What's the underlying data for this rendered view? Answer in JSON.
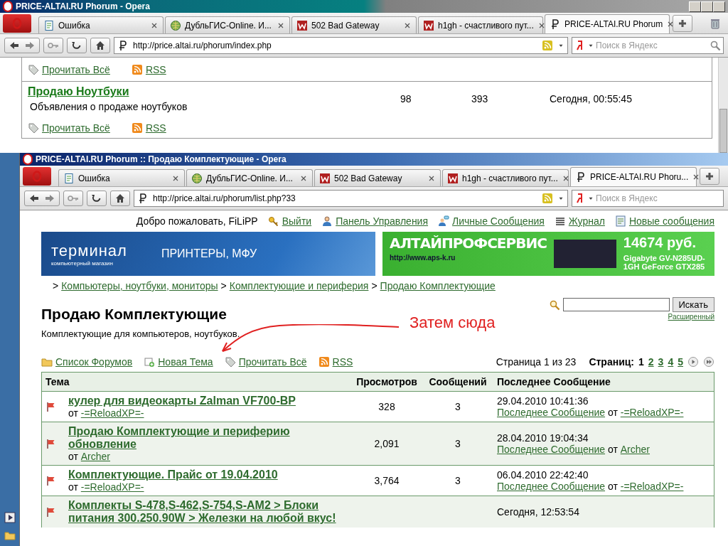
{
  "back_window": {
    "title": "PRICE-ALTAI.RU Phorum - Opera",
    "tabs": [
      {
        "label": "Ошибка",
        "kind": "page",
        "selected": false
      },
      {
        "label": "ДубльГИС-Online. И...",
        "kind": "globe",
        "selected": false
      },
      {
        "label": "502 Bad Gateway",
        "kind": "w",
        "selected": false
      },
      {
        "label": "h1gh - счастливого пут...",
        "kind": "w",
        "selected": false
      },
      {
        "label": "PRICE-ALTAI.RU Phorum",
        "kind": "p",
        "selected": true
      }
    ],
    "address": "http://price.altai.ru/phorum/index.php",
    "search_placeholder": "Поиск в Яндекс",
    "forum_rows": [
      {
        "links": [
          {
            "label": "Прочитать Всё",
            "kind": "tag"
          },
          {
            "label": "RSS",
            "kind": "rss"
          }
        ]
      },
      {
        "title": "Продаю Ноутбуки",
        "description": "Объявления о продаже ноутбуков",
        "topics": "98",
        "posts": "393",
        "last_post": "Сегодня, 00:55:45",
        "links": [
          {
            "label": "Прочитать Всё",
            "kind": "tag"
          },
          {
            "label": "RSS",
            "kind": "rss"
          }
        ]
      }
    ]
  },
  "front_window": {
    "title": "PRICE-ALTAI.RU Phorum :: Продаю Комплектующие - Opera",
    "tabs": [
      {
        "label": "Ошибка",
        "kind": "page",
        "selected": false
      },
      {
        "label": "ДубльГИС-Online. И...",
        "kind": "globe",
        "selected": false
      },
      {
        "label": "502 Bad Gateway",
        "kind": "w",
        "selected": false
      },
      {
        "label": "h1gh - счастливого пут...",
        "kind": "w",
        "selected": false
      },
      {
        "label": "PRICE-ALTAI.RU Phoru...",
        "kind": "p",
        "selected": true
      }
    ],
    "address": "http://price.altai.ru/phorum/list.php?33",
    "search_placeholder": "Поиск в Яндекс",
    "page": {
      "welcome": "Добро пожаловать, FiLiPP",
      "user_links": [
        {
          "label": "Выйти",
          "kind": "key"
        },
        {
          "label": "Панель Управления",
          "kind": "person"
        },
        {
          "label": "Личные Сообщения",
          "kind": "chat"
        },
        {
          "label": "Журнал",
          "kind": "list"
        },
        {
          "label": "Новые сообщения",
          "kind": "doc"
        }
      ],
      "banners": [
        {
          "kind": "terminal",
          "texts": [
            "терминал",
            "компьютерный магазин",
            "ПРИНТЕРЫ, МФУ"
          ]
        },
        {
          "kind": "aps",
          "texts": [
            "АЛТАЙПРОФСЕРВИС",
            "http://www.aps-k.ru",
            "14674 руб.",
            "Gigabyte GV-N285UD-1GH GeForce GTX285"
          ]
        }
      ],
      "breadcrumb_separator": ">",
      "breadcrumb": [
        "Компьютеры, ноутбуки, мониторы",
        "Комплектующие и периферия",
        "Продаю Комплектующие"
      ],
      "heading": "Продаю Комплектующие",
      "description": "Комплектующие для компьютеров, ноутбуков.",
      "search": {
        "button": "Искать",
        "advanced": "Расширенный"
      },
      "annotation": "Затем сюда",
      "actions": [
        {
          "label": "Список Форумов",
          "kind": "folder"
        },
        {
          "label": "Новая Тема",
          "kind": "new"
        },
        {
          "label": "Прочитать Всё",
          "kind": "tag"
        },
        {
          "label": "RSS",
          "kind": "rss"
        }
      ],
      "page_info": "Страница 1 из 23",
      "pages_label": "Страниц:",
      "pages": [
        {
          "label": "1",
          "selected": true
        },
        {
          "label": "2",
          "selected": false
        },
        {
          "label": "3",
          "selected": false
        },
        {
          "label": "4",
          "selected": false
        },
        {
          "label": "5",
          "selected": false
        }
      ],
      "table": {
        "columns": [
          "Тема",
          "Просмотров",
          "Сообщений",
          "Последнее Сообщение"
        ],
        "rows": [
          {
            "title": "кулер для видеокарты Zalman VF700-BP",
            "by": "от",
            "author": "-=ReloadXP=-",
            "views": "328",
            "replies": "3",
            "date": "29.04.2010 10:41:36",
            "last_link": "Последнее Сообщение",
            "last_by": "от",
            "last_author": "-=ReloadXP=-"
          },
          {
            "title": "Продаю Комплектующие и периферию обновление",
            "by": "от",
            "author": "Archer",
            "views": "2,091",
            "replies": "3",
            "date": "28.04.2010 19:04:34",
            "last_link": "Последнее Сообщение",
            "last_by": "от",
            "last_author": "Archer"
          },
          {
            "title": "Комплектующие. Прайс от 19.04.2010",
            "by": "от",
            "author": "-=ReloadXP=-",
            "views": "3,764",
            "replies": "3",
            "date": "06.04.2010 22:42:40",
            "last_link": "Последнее Сообщение",
            "last_by": "от",
            "last_author": "-=ReloadXP=-"
          },
          {
            "title": "Комплекты S-478,S-462,S-754,S-AM2 > Блоки питания 300.250.90W > Железки на любой вкус!",
            "date": "Сегодня, 12:53:54"
          }
        ]
      }
    }
  }
}
